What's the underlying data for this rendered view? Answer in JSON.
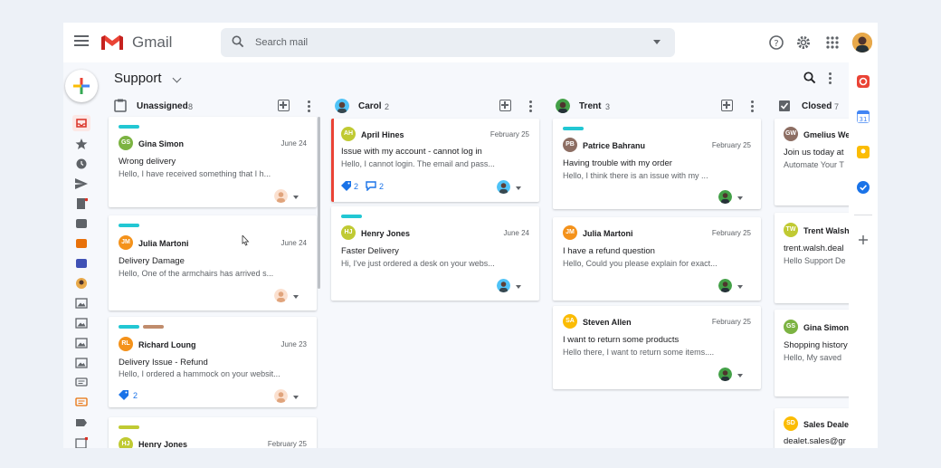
{
  "header": {
    "app_name": "Gmail",
    "search_placeholder": "Search mail"
  },
  "board": {
    "title": "Support"
  },
  "columns": [
    {
      "name": "Unassigned",
      "count": "8",
      "cards": [
        {
          "tags": [
            "#22c7d3"
          ],
          "initials": "GS",
          "avatar_color": "#7cb342",
          "sender": "Gina Simon",
          "date": "June 24",
          "subject": "Wrong delivery",
          "snippet": "Hello, I have received something that I h...",
          "meta": ""
        },
        {
          "tags": [
            "#22c7d3"
          ],
          "initials": "JM",
          "avatar_color": "#f4921b",
          "sender": "Julia Martoni",
          "date": "June 24",
          "subject": "Delivery Damage",
          "snippet": "Hello, One of the armchairs has arrived s...",
          "meta": ""
        },
        {
          "tags": [
            "#22c7d3",
            "#c08c6c"
          ],
          "initials": "RL",
          "avatar_color": "#f4921b",
          "sender": "Richard Loung",
          "date": "June 23",
          "subject": "Delivery Issue - Refund",
          "snippet": "Hello, I ordered a hammock on your websit...",
          "meta": "2"
        },
        {
          "tags": [
            "#c0ca33"
          ],
          "initials": "HJ",
          "avatar_color": "#c0ca33",
          "sender": "Henry Jones",
          "date": "February 25",
          "subject": "",
          "snippet": "",
          "meta": ""
        }
      ]
    },
    {
      "name": "Carol",
      "count": "2",
      "cards": [
        {
          "tags": [],
          "initials": "AH",
          "avatar_color": "#c0ca33",
          "sender": "April Hines",
          "date": "February 25",
          "subject": "Issue with my account - cannot log in",
          "snippet": "Hello, I cannot login. The email and pass...",
          "meta": "2",
          "meta2": "2"
        },
        {
          "tags": [
            "#22c7d3"
          ],
          "initials": "HJ",
          "avatar_color": "#c0ca33",
          "sender": "Henry Jones",
          "date": "June 24",
          "subject": "Faster Delivery",
          "snippet": "Hi, I've just ordered a desk on your webs...",
          "meta": ""
        }
      ]
    },
    {
      "name": "Trent",
      "count": "3",
      "cards": [
        {
          "tags": [
            "#22c7d3"
          ],
          "initials": "PB",
          "avatar_color": "#8d6e63",
          "sender": "Patrice Bahranu",
          "date": "February 25",
          "subject": "Having trouble with my order",
          "snippet": "Hello, I think there is an issue with my ...",
          "meta": ""
        },
        {
          "tags": [],
          "initials": "JM",
          "avatar_color": "#f4921b",
          "sender": "Julia Martoni",
          "date": "February 25",
          "subject": "I have a refund question",
          "snippet": "Hello, Could you please explain for exact...",
          "meta": ""
        },
        {
          "tags": [],
          "initials": "SA",
          "avatar_color": "#fbbc04",
          "sender": "Steven Allen",
          "date": "February 25",
          "subject": "I want to return some products",
          "snippet": "Hello there, I want to return some items....",
          "meta": ""
        }
      ]
    },
    {
      "name": "Closed",
      "count": "7",
      "cards": [
        {
          "initials": "GW",
          "avatar_color": "#8d6e63",
          "sender": "Gmelius We",
          "subject": "Join us today at",
          "snippet": "Automate Your T"
        },
        {
          "initials": "TW",
          "avatar_color": "#c0ca33",
          "sender": "Trent Walsh",
          "subject": "trent.walsh.deal",
          "snippet": "Hello Support De"
        },
        {
          "initials": "GS",
          "avatar_color": "#7cb342",
          "sender": "Gina Simon",
          "subject": "Shopping history",
          "snippet": "Hello, My saved"
        },
        {
          "initials": "SD",
          "avatar_color": "#fbbc04",
          "sender": "Sales Deale",
          "subject": "dealet.sales@gr",
          "snippet": ""
        }
      ]
    }
  ],
  "colors": {
    "gmail_red": "#ea4335",
    "accent_blue": "#1a73e8",
    "tag_cyan": "#22c7d3"
  }
}
